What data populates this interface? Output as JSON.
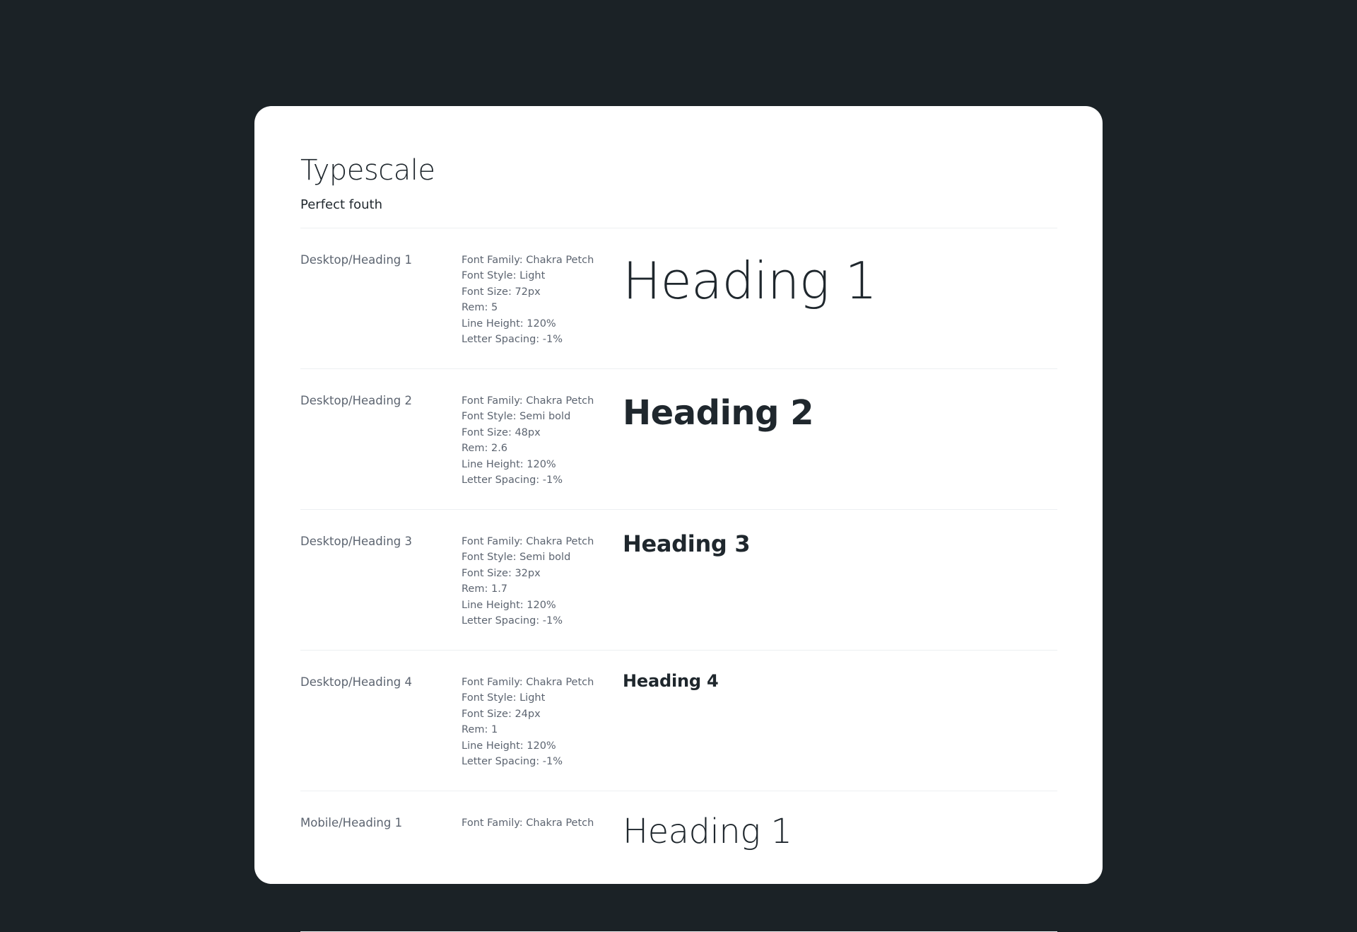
{
  "page": {
    "title": "Typescale",
    "subtitle": "Perfect fouth"
  },
  "rows": [
    {
      "name": "Desktop/Heading 1",
      "specs": [
        "Font Family: Chakra Petch",
        "Font Style: Light",
        "Font Size: 72px",
        "Rem: 5",
        "Line Height: 120%",
        "Letter Spacing: -1%"
      ],
      "sample": "Heading 1"
    },
    {
      "name": "Desktop/Heading 2",
      "specs": [
        "Font Family: Chakra Petch",
        "Font Style: Semi bold",
        "Font Size: 48px",
        "Rem: 2.6",
        "Line Height: 120%",
        "Letter Spacing: -1%"
      ],
      "sample": "Heading 2"
    },
    {
      "name": "Desktop/Heading 3",
      "specs": [
        "Font Family: Chakra Petch",
        "Font Style: Semi bold",
        "Font Size: 32px",
        "Rem: 1.7",
        "Line Height: 120%",
        "Letter Spacing: -1%"
      ],
      "sample": "Heading 3"
    },
    {
      "name": "Desktop/Heading 4",
      "specs": [
        "Font Family: Chakra Petch",
        "Font Style: Light",
        "Font Size: 24px",
        "Rem: 1",
        "Line Height: 120%",
        "Letter Spacing: -1%"
      ],
      "sample": "Heading 4"
    },
    {
      "name": "Mobile/Heading 1",
      "specs": [
        "Font Family: Chakra Petch"
      ],
      "sample": "Heading 1"
    }
  ]
}
